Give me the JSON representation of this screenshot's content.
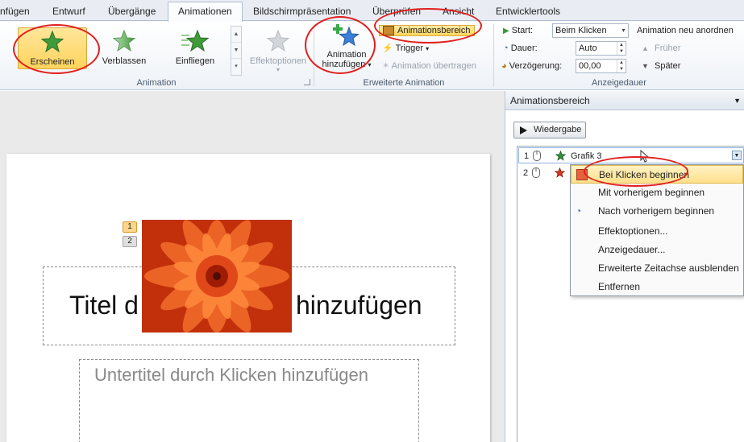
{
  "tabs": [
    {
      "label": "nfügen",
      "active": false
    },
    {
      "label": "Entwurf",
      "active": false
    },
    {
      "label": "Übergänge",
      "active": false
    },
    {
      "label": "Animationen",
      "active": true
    },
    {
      "label": "Bildschirmpräsentation",
      "active": false
    },
    {
      "label": "Überprüfen",
      "active": false
    },
    {
      "label": "Ansicht",
      "active": false
    },
    {
      "label": "Entwicklertools",
      "active": false
    }
  ],
  "ribbon": {
    "animation_group": {
      "label": "Animation",
      "effects": [
        {
          "label": "Erscheinen",
          "selected": true
        },
        {
          "label": "Verblassen",
          "selected": false
        },
        {
          "label": "Einfliegen",
          "selected": false
        }
      ],
      "effect_options": "Effektoptionen"
    },
    "advanced_group": {
      "label": "Erweiterte Animation",
      "add_animation_line1": "Animation",
      "add_animation_line2": "hinzufügen",
      "animation_pane": "Animationsbereich",
      "trigger": "Trigger",
      "animation_painter": "Animation übertragen"
    },
    "timing_group": {
      "label": "Anzeigedauer",
      "start_label": "Start:",
      "start_value": "Beim Klicken",
      "duration_label": "Dauer:",
      "duration_value": "Auto",
      "delay_label": "Verzögerung:",
      "delay_value": "00,00",
      "reorder_label": "Animation neu anordnen",
      "earlier": "Früher",
      "later": "Später"
    }
  },
  "slide": {
    "title_left": "Titel d",
    "title_right": "hinzufügen",
    "subtitle": "Untertitel durch Klicken hinzufügen",
    "badges": [
      "1",
      "2"
    ]
  },
  "pane": {
    "title": "Animationsbereich",
    "play_label": "Wiedergabe",
    "items": [
      {
        "num": "1",
        "label": "Grafik 3",
        "star_color": "#2f8f3a"
      },
      {
        "num": "2",
        "label": "",
        "star_color": "#d9371f"
      }
    ]
  },
  "context_menu": {
    "items": [
      {
        "label": "Bei Klicken beginnen",
        "hover": true
      },
      {
        "label": "Mit vorherigem beginnen",
        "hover": false
      },
      {
        "label": "Nach vorherigem beginnen",
        "hover": false
      },
      {
        "label": "Effektoptionen...",
        "hover": false
      },
      {
        "label": "Anzeigedauer...",
        "hover": false
      },
      {
        "label": "Erweiterte Zeitachse ausblenden",
        "hover": false
      },
      {
        "label": "Entfernen",
        "hover": false
      }
    ]
  },
  "colors": {
    "accent": "#ffd45d",
    "annotation": "#e21e1e",
    "flower": "#d9451a"
  }
}
